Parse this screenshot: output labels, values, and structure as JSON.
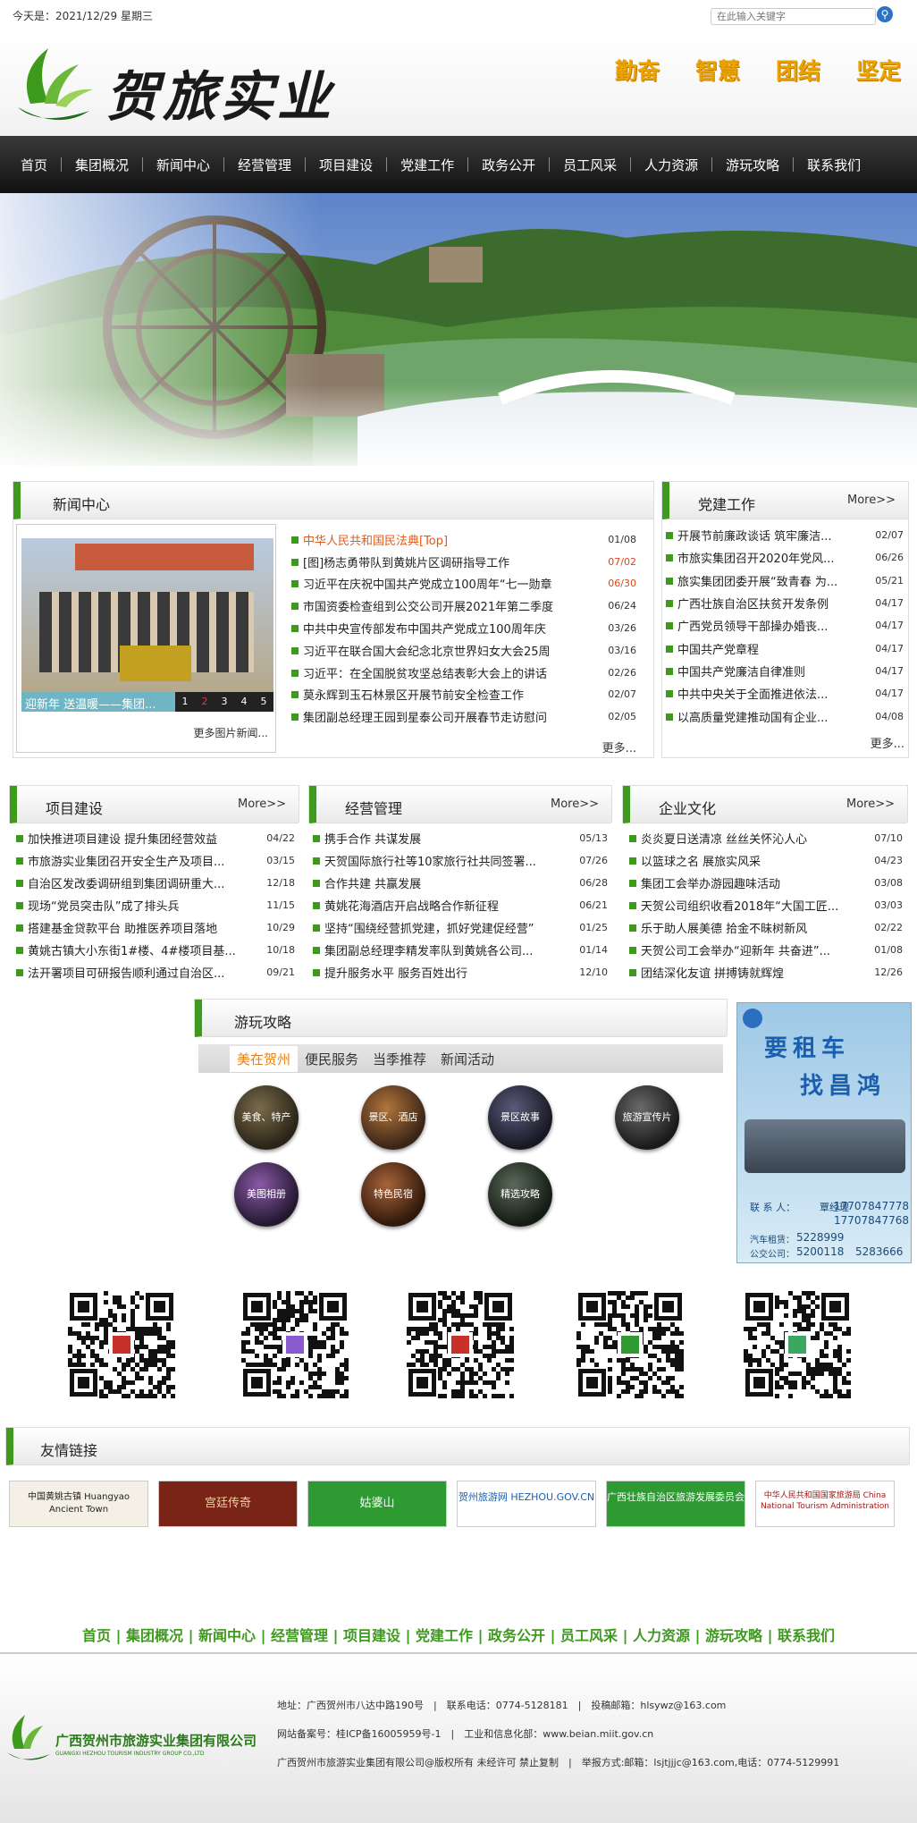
{
  "topbar": {
    "date": "今天是：2021/12/29 星期三",
    "search_placeholder": "在此输入关键字"
  },
  "header": {
    "logo_text": "贺旅实业",
    "slogans": [
      "勤奋",
      "智慧",
      "团结",
      "坚定"
    ]
  },
  "nav": [
    "首页",
    "集团概况",
    "新闻中心",
    "经营管理",
    "项目建设",
    "党建工作",
    "政务公开",
    "员工风采",
    "人力资源",
    "游玩攻略",
    "联系我们"
  ],
  "news": {
    "title": "新闻中心",
    "photo_caption": "迎新年 送温暖——集团...",
    "photo_pages": [
      "1",
      "2",
      "3",
      "4",
      "5"
    ],
    "photo_more": "更多图片新闻...",
    "more": "更多...",
    "items": [
      {
        "text": "中华人民共和国民法典[Top]",
        "date": "01/08",
        "style": "orange"
      },
      {
        "text": "[图]杨志勇带队到黄姚片区调研指导工作",
        "date": "07/02",
        "style": "red"
      },
      {
        "text": "习近平在庆祝中国共产党成立100周年“七一勋章",
        "date": "06/30",
        "style": "red"
      },
      {
        "text": "市国资委检查组到公交公司开展2021年第二季度",
        "date": "06/24",
        "style": ""
      },
      {
        "text": "中共中央宣传部发布中国共产党成立100周年庆",
        "date": "03/26",
        "style": ""
      },
      {
        "text": "习近平在联合国大会纪念北京世界妇女大会25周",
        "date": "03/16",
        "style": ""
      },
      {
        "text": "习近平：在全国脱贫攻坚总结表彰大会上的讲话",
        "date": "02/26",
        "style": ""
      },
      {
        "text": "莫永辉到玉石林景区开展节前安全检查工作",
        "date": "02/07",
        "style": ""
      },
      {
        "text": "集团副总经理王园到星泰公司开展春节走访慰问",
        "date": "02/05",
        "style": ""
      }
    ]
  },
  "party": {
    "title": "党建工作",
    "more": "More>>",
    "more2": "更多...",
    "items": [
      {
        "text": "开展节前廉政谈话 筑牢廉洁...",
        "date": "02/07"
      },
      {
        "text": "市旅实集团召开2020年党风...",
        "date": "06/26"
      },
      {
        "text": "旅实集团团委开展“致青春 为...",
        "date": "05/21"
      },
      {
        "text": "广西壮族自治区扶贫开发条例",
        "date": "04/17"
      },
      {
        "text": "广西党员领导干部操办婚丧...",
        "date": "04/17"
      },
      {
        "text": "中国共产党章程",
        "date": "04/17"
      },
      {
        "text": "中国共产党廉洁自律准则",
        "date": "04/17"
      },
      {
        "text": "中共中央关于全面推进依法...",
        "date": "04/17"
      },
      {
        "text": "以高质量党建推动国有企业...",
        "date": "04/08"
      }
    ]
  },
  "project": {
    "title": "项目建设",
    "more": "More>>",
    "items": [
      {
        "text": "加快推进项目建设 提升集团经营效益",
        "date": "04/22"
      },
      {
        "text": "市旅游实业集团召开安全生产及项目...",
        "date": "03/15"
      },
      {
        "text": "自治区发改委调研组到集团调研重大...",
        "date": "12/18"
      },
      {
        "text": "现场“党员突击队”成了排头兵",
        "date": "11/15"
      },
      {
        "text": "搭建基金贷款平台 助推医养项目落地",
        "date": "10/29"
      },
      {
        "text": "黄姚古镇大小东街1#楼、4#楼项目基...",
        "date": "10/18"
      },
      {
        "text": "法开署项目可研报告顺利通过自治区...",
        "date": "09/21"
      }
    ]
  },
  "business": {
    "title": "经营管理",
    "more": "More>>",
    "items": [
      {
        "text": "携手合作 共谋发展",
        "date": "05/13"
      },
      {
        "text": "天贺国际旅行社等10家旅行社共同签署...",
        "date": "07/26"
      },
      {
        "text": "合作共建 共赢发展",
        "date": "06/28"
      },
      {
        "text": "黄姚花海酒店开启战略合作新征程",
        "date": "06/21"
      },
      {
        "text": "坚持“围绕经营抓党建，抓好党建促经营”",
        "date": "01/25"
      },
      {
        "text": "集团副总经理李精发率队到黄姚各公司...",
        "date": "01/14"
      },
      {
        "text": "提升服务水平 服务百姓出行",
        "date": "12/10"
      }
    ]
  },
  "culture": {
    "title": "企业文化",
    "more": "More>>",
    "items": [
      {
        "text": "炎炎夏日送清凉 丝丝关怀沁人心",
        "date": "07/10"
      },
      {
        "text": "以篮球之名 展旅实风采",
        "date": "04/23"
      },
      {
        "text": "集团工会举办游园趣味活动",
        "date": "03/08"
      },
      {
        "text": "天贺公司组织收看2018年“大国工匠...",
        "date": "03/03"
      },
      {
        "text": "乐于助人展美德 拾金不昧树新风",
        "date": "02/22"
      },
      {
        "text": "天贺公司工会举办“迎新年 共奋进”...",
        "date": "01/08"
      },
      {
        "text": "团结深化友谊 拼搏铸就辉煌",
        "date": "12/26"
      }
    ]
  },
  "travel": {
    "title": "游玩攻略",
    "tabs": [
      "美在贺州",
      "便民服务",
      "当季推荐",
      "新闻活动"
    ],
    "circles": [
      "美食、特产",
      "景区、酒店",
      "景区故事",
      "旅游宣传片",
      "美图相册",
      "特色民宿",
      "精选攻略"
    ]
  },
  "ad": {
    "line1": "要租车",
    "line2": "找昌鸿",
    "contact_label": "联 系 人：",
    "contact_name": "覃经理",
    "phone1": "17707847778",
    "phone2": "17707847768",
    "car_label": "汽车租赁：",
    "car_phone": "5228999",
    "bus_label": "公交公司：",
    "bus_phone1": "5200118",
    "bus_phone2": "5283666"
  },
  "links": {
    "title": "友情链接",
    "logos": [
      "中国黄姚古镇 Huangyao Ancient Town",
      "宫廷传奇",
      "姑婆山",
      "贺州旅游网 HEZHOU.GOV.CN",
      "广西壮族自治区旅游发展委员会",
      "中华人民共和国国家旅游局 China National Tourism Administration"
    ]
  },
  "footnav": [
    "首页",
    "集团概况",
    "新闻中心",
    "经营管理",
    "项目建设",
    "党建工作",
    "政务公开",
    "员工风采",
    "人力资源",
    "游玩攻略",
    "联系我们"
  ],
  "footer": {
    "company": "广西贺州市旅游实业集团有限公司",
    "company_en": "GUANGXI HEZHOU TOURISM INDUSTRY GROUP CO.,LTD",
    "line1": "地址：广西贺州市八达中路190号　|　联系电话：0774-5128181　|　投稿邮箱：hlsywz@163.com",
    "line2": "网站备案号：桂ICP备16005959号-1　|　工业和信息化部：www.beian.miit.gov.cn",
    "line3": "广西贺州市旅游实业集团有限公司@版权所有 未经许可 禁止复制　|　举报方式:邮箱：lsjtjjjc@163.com,电话：0774-5129991"
  },
  "colors": {
    "accent_green": "#3e9a1d",
    "date_red": "#e0441a",
    "slogan": "#e9a400"
  }
}
